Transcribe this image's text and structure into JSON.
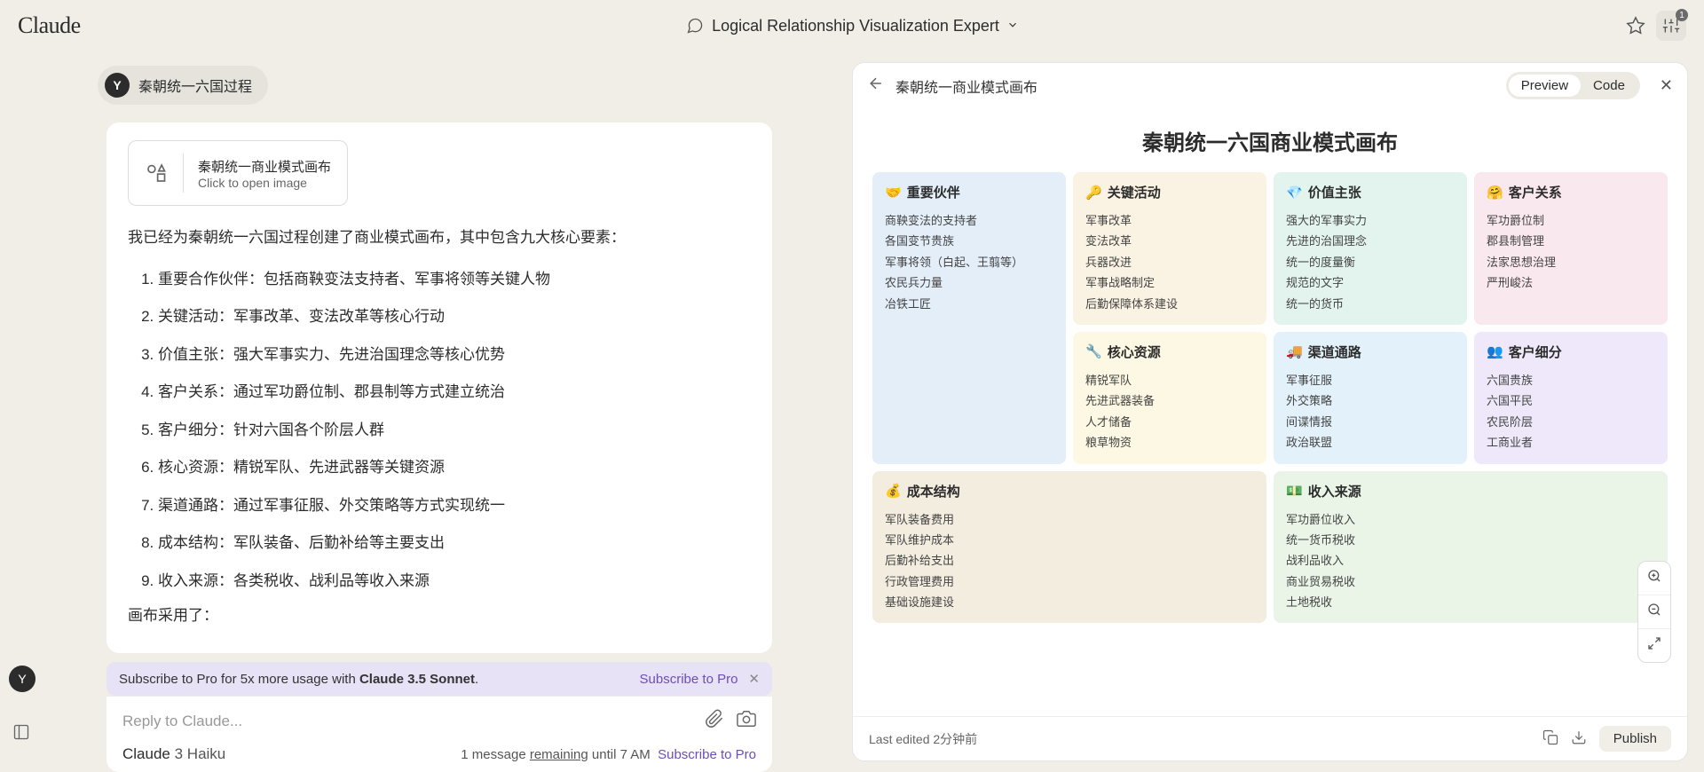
{
  "header": {
    "logo": "Claude",
    "center_title": "Logical Relationship Visualization Expert",
    "badge": "1"
  },
  "user_chip": {
    "avatar": "Y",
    "text": "秦朝统一六国过程"
  },
  "image_card": {
    "title": "秦朝统一商业模式画布",
    "subtitle": "Click to open image"
  },
  "intro": "我已经为秦朝统一六国过程创建了商业模式画布，其中包含九大核心要素：",
  "list_items": [
    "重要合作伙伴：包括商鞅变法支持者、军事将领等关键人物",
    "关键活动：军事改革、变法改革等核心行动",
    "价值主张：强大军事实力、先进治国理念等核心优势",
    "客户关系：通过军功爵位制、郡县制等方式建立统治",
    "客户细分：针对六国各个阶层人群",
    "核心资源：精锐军队、先进武器等关键资源",
    "渠道通路：通过军事征服、外交策略等方式实现统一",
    "成本结构：军队装备、后勤补给等主要支出",
    "收入来源：各类税收、战利品等收入来源"
  ],
  "outro": "画布采用了：",
  "banner": {
    "text_a": "Subscribe to Pro for 5x more usage with ",
    "text_b": "Claude 3.5 Sonnet",
    "link": "Subscribe to Pro"
  },
  "input": {
    "placeholder": "Reply to Claude...",
    "model": "Claude 3 Haiku",
    "remaining_a": "1 message ",
    "remaining_b": "remaining",
    "remaining_c": " until 7 AM",
    "sub_link": "Subscribe to Pro"
  },
  "artifact": {
    "title": "秦朝统一商业模式画布",
    "toggle": {
      "preview": "Preview",
      "code": "Code"
    },
    "canvas_title": "秦朝统一六国商业模式画布",
    "cells": {
      "partners": {
        "title": "重要伙伴",
        "icon": "🤝",
        "items": [
          "商鞅变法的支持者",
          "各国变节贵族",
          "军事将领（白起、王翦等）",
          "农民兵力量",
          "冶铁工匠"
        ]
      },
      "activities": {
        "title": "关键活动",
        "icon": "🔑",
        "items": [
          "军事改革",
          "变法改革",
          "兵器改进",
          "军事战略制定",
          "后勤保障体系建设"
        ]
      },
      "value": {
        "title": "价值主张",
        "icon": "💎",
        "items": [
          "强大的军事实力",
          "先进的治国理念",
          "统一的度量衡",
          "规范的文字",
          "统一的货币"
        ]
      },
      "relations": {
        "title": "客户关系",
        "icon": "🤗",
        "items": [
          "军功爵位制",
          "郡县制管理",
          "法家思想治理",
          "严刑峻法"
        ]
      },
      "resources": {
        "title": "核心资源",
        "icon": "🔧",
        "items": [
          "精锐军队",
          "先进武器装备",
          "人才储备",
          "粮草物资"
        ]
      },
      "channels": {
        "title": "渠道通路",
        "icon": "🚚",
        "items": [
          "军事征服",
          "外交策略",
          "间谍情报",
          "政治联盟"
        ]
      },
      "segments": {
        "title": "客户细分",
        "icon": "👥",
        "items": [
          "六国贵族",
          "六国平民",
          "农民阶层",
          "工商业者"
        ]
      },
      "costs": {
        "title": "成本结构",
        "icon": "💰",
        "items": [
          "军队装备费用",
          "军队维护成本",
          "后勤补给支出",
          "行政管理费用",
          "基础设施建设"
        ]
      },
      "revenue": {
        "title": "收入来源",
        "icon": "💵",
        "items": [
          "军功爵位收入",
          "统一货币税收",
          "战利品收入",
          "商业贸易税收",
          "土地税收"
        ]
      }
    },
    "footer": {
      "edited": "Last edited 2分钟前",
      "publish": "Publish"
    }
  },
  "side_avatar": "Y"
}
